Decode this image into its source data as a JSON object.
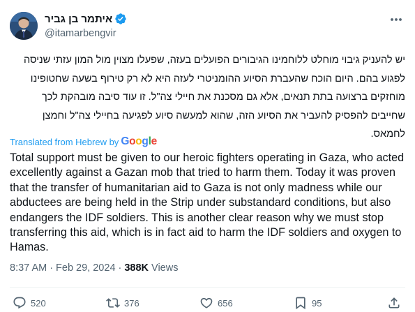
{
  "author": {
    "display_name": "איתמר בן גביר",
    "handle": "@itamarbengvir",
    "verified": true
  },
  "tweet": {
    "hebrew_text": "יש להעניק גיבוי מוחלט ללוחמינו הגיבורים הפועלים בעזה, שפעלו מצוין מול המון עזתי שניסה לפגוע בהם. היום הוכח שהעברת הסיוע ההומניטרי לעזה היא לא רק טירוף בשעה שחטופינו מוחזקים ברצועה בתת תנאים, אלא גם מסכנת את חיילי צה\"ל. זו עוד סיבה מובהקת לכך שחייבים להפסיק להעביר את הסיוע הזה, שהוא למעשה סיוע לפגיעה בחיילי צה\"ל וחמצן לחמאס.",
    "translated_label": "Translated from Hebrew by",
    "translation_provider": "Google",
    "english_text": "Total support must be given to our heroic fighters operating in Gaza, who acted excellently against a Gazan mob that tried to harm them. Today it was proven that the transfer of humanitarian aid to Gaza is not only madness while our abductees are being held in the Strip under substandard conditions, but also endangers the IDF soldiers. This is another clear reason why we must stop transferring this aid, which is in fact aid to harm the IDF soldiers and oxygen to Hamas.",
    "time": "8:37 AM",
    "separator": "·",
    "date": "Feb 29, 2024",
    "views_count": "388K",
    "views_label": "Views"
  },
  "actions": {
    "replies": "520",
    "reposts": "376",
    "likes": "656",
    "bookmarks": "95"
  },
  "icons": {
    "more": "more-horizontal-icon",
    "verified": "verified-badge-icon",
    "reply": "reply-icon",
    "repost": "repost-icon",
    "like": "heart-icon",
    "bookmark": "bookmark-icon",
    "share": "share-icon"
  },
  "colors": {
    "accent": "#1d9bf0",
    "text": "#0f1419",
    "secondary": "#536471",
    "divider": "#eff3f4"
  }
}
